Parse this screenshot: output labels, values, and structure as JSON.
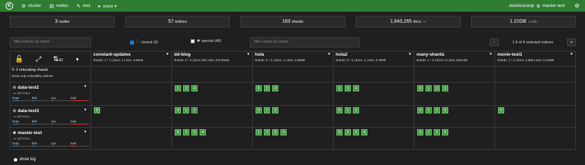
{
  "nav": {
    "logo_letter": "K",
    "items": [
      {
        "label": "cluster",
        "icon": "cluster-icon",
        "glyph": "⚙"
      },
      {
        "label": "nodes",
        "icon": "nodes-icon",
        "glyph": "▤"
      },
      {
        "label": "rest",
        "icon": "rest-icon",
        "glyph": "✎"
      },
      {
        "label": "more ▾",
        "icon": "more-icon",
        "glyph": "▸"
      }
    ],
    "cluster_name": "elasticsnoop",
    "node_name": "master-test",
    "gear_icon": "⚙"
  },
  "stats": {
    "nodes_value": "3",
    "nodes_label": "nodes",
    "indices_value": "57",
    "indices_label": "indices",
    "shards_value": "163",
    "shards_label": "shards",
    "docs_value": "1,843,265",
    "docs_label": "docs",
    "docs_delta": "+1",
    "size_value": "1.21GB",
    "size_delta": "+2.03b"
  },
  "filters": {
    "indices_placeholder": "filter indices by name",
    "closed_label": "closed (0)",
    "special_label": "special (48)",
    "nodes_placeholder": "filter nodes by name",
    "pagination_text": "1-6 of 9 selected indices",
    "prev": "«",
    "next": "»"
  },
  "controls": {
    "lock": "🔓",
    "expand": "⤢",
    "sort": "⇅",
    "sort_letters": "AZ",
    "dropdown": "▾",
    "relocating": "2 relocating shards",
    "unhealthy": "show only unhealthy indices"
  },
  "indices": [
    {
      "name": "constant-updates",
      "meta": "shards: 1 * 1 | docs: 2 | size: 3.94KB"
    },
    {
      "name": "dd-blog",
      "meta": "shards: 5 * 2 | docs: 85 | size: 975.94KB"
    },
    {
      "name": "hola",
      "meta": "shards: 5 * 2 | docs: 1 | size: 3.95KB"
    },
    {
      "name": "hola2",
      "meta": "shards: 5 * 2 | docs: 1 | size: 3.79KB"
    },
    {
      "name": "many-shards",
      "meta": "shards: 4 * 3 | docs: 0 | size: 636.00b"
    },
    {
      "name": "movie-test1",
      "meta": "shards: 1 * 1 | docs: 4,809 | size: 5.41MB"
    }
  ],
  "nodes": [
    {
      "name": "data-test2",
      "ip": "127.0.0.1",
      "star": "☆",
      "shards": [
        [],
        [
          "1",
          "3",
          "4"
        ],
        [
          "0",
          "3",
          "4"
        ],
        [
          "1",
          "3",
          "4"
        ],
        [
          "0",
          "1",
          "2",
          "3"
        ],
        []
      ],
      "heap": 0.35,
      "disk": 0.15,
      "cpu": 0.1,
      "load": 0.9
    },
    {
      "name": "data-test3",
      "ip": "127.0.0.1",
      "star": "☆",
      "shards": [
        [
          "0"
        ],
        [
          "0",
          "1",
          "2"
        ],
        [
          "0",
          "1",
          "2"
        ],
        [
          "0",
          "1",
          "2"
        ],
        [
          "0",
          "1",
          "2",
          "3"
        ],
        [
          "0"
        ]
      ],
      "heap": 0.3,
      "disk": 0.15,
      "cpu": 0.1,
      "load": 0.9
    },
    {
      "name": "master-test",
      "ip": "127.0.0.1",
      "star": "★",
      "shards": [
        [],
        [
          "0",
          "2",
          "3",
          "4"
        ],
        [
          "1",
          "2",
          "3",
          "4"
        ],
        [
          "0",
          "2",
          "3",
          "4"
        ],
        [
          "0",
          "1",
          "2",
          "3"
        ],
        []
      ],
      "heap": 0.3,
      "disk": 0.15,
      "cpu": 0.1,
      "load": 0.25
    }
  ],
  "metric_labels": {
    "heap": "heap",
    "disk": "disk",
    "cpu": "cpu",
    "load": "load"
  },
  "footer": {
    "show_log": "show log"
  }
}
